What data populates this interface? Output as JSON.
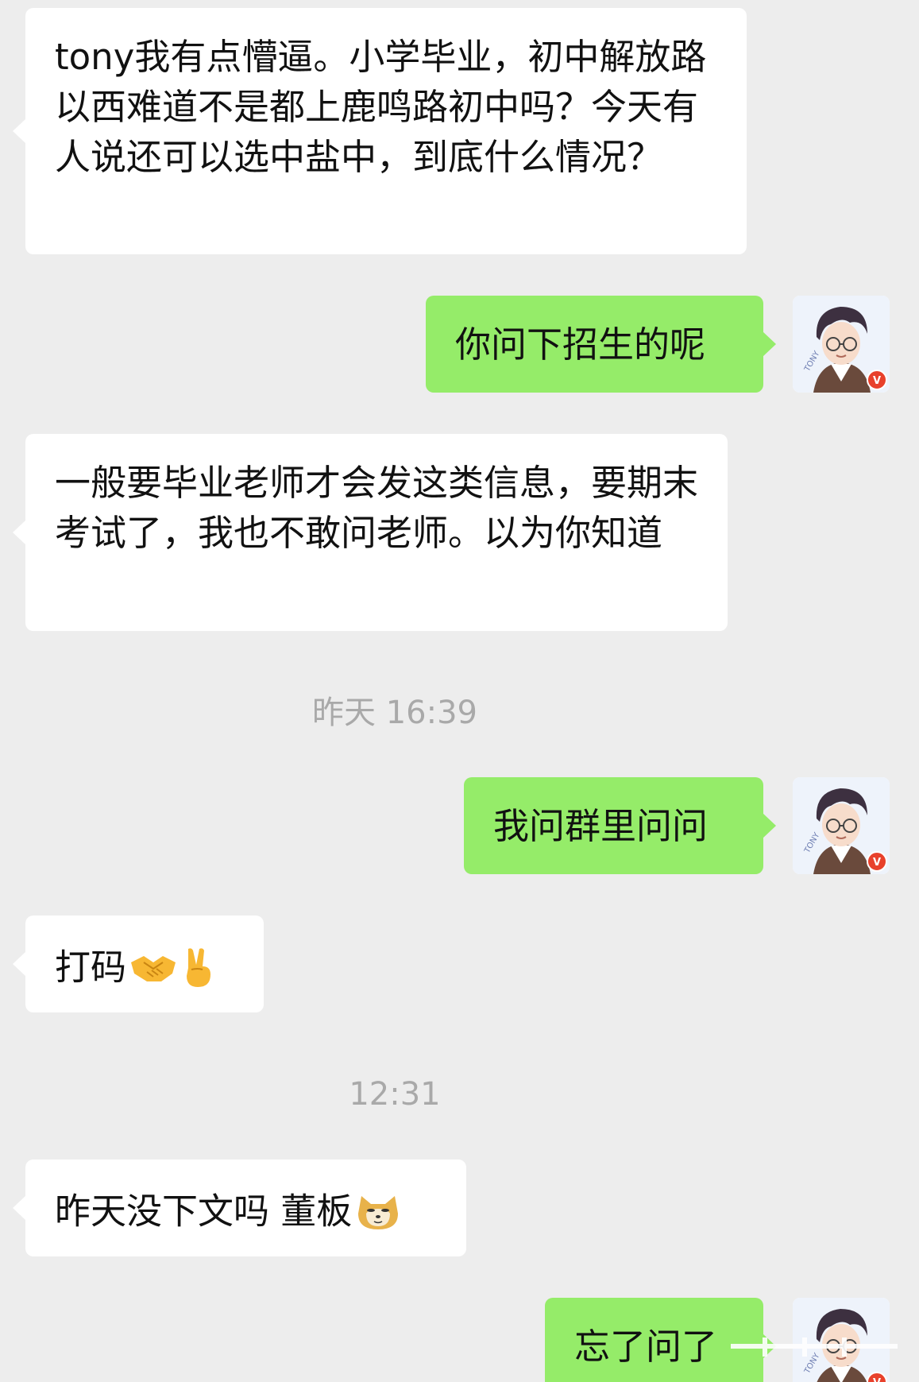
{
  "messages": [
    {
      "side": "in",
      "text": "tony我有点懵逼。小学毕业，初中解放路以西难道不是都上鹿鸣路初中吗？今天有人说还可以选中盐中，到底什么情况？"
    },
    {
      "side": "out",
      "text": "你问下招生的呢"
    },
    {
      "side": "in",
      "text": "一般要毕业老师才会发这类信息，要期末考试了，我也不敢问老师。以为你知道"
    },
    {
      "side": "out",
      "text": "我问群里问问"
    },
    {
      "side": "in",
      "text": "打码",
      "emojis": [
        "handshake-emoji",
        "victory-hand-emoji"
      ]
    },
    {
      "side": "in",
      "text": "昨天没下文吗 董板",
      "emojis": [
        "doge-emoji"
      ]
    },
    {
      "side": "out",
      "text": "忘了问了"
    }
  ],
  "timestamps": [
    "昨天 16:39",
    "12:31"
  ],
  "avatar": {
    "badge": "V",
    "name_tag": "TONY"
  },
  "colors": {
    "background": "#ededed",
    "incoming_bubble": "#ffffff",
    "outgoing_bubble": "#95ec69",
    "timestamp": "#a9a9a9",
    "badge": "#e8412c"
  }
}
